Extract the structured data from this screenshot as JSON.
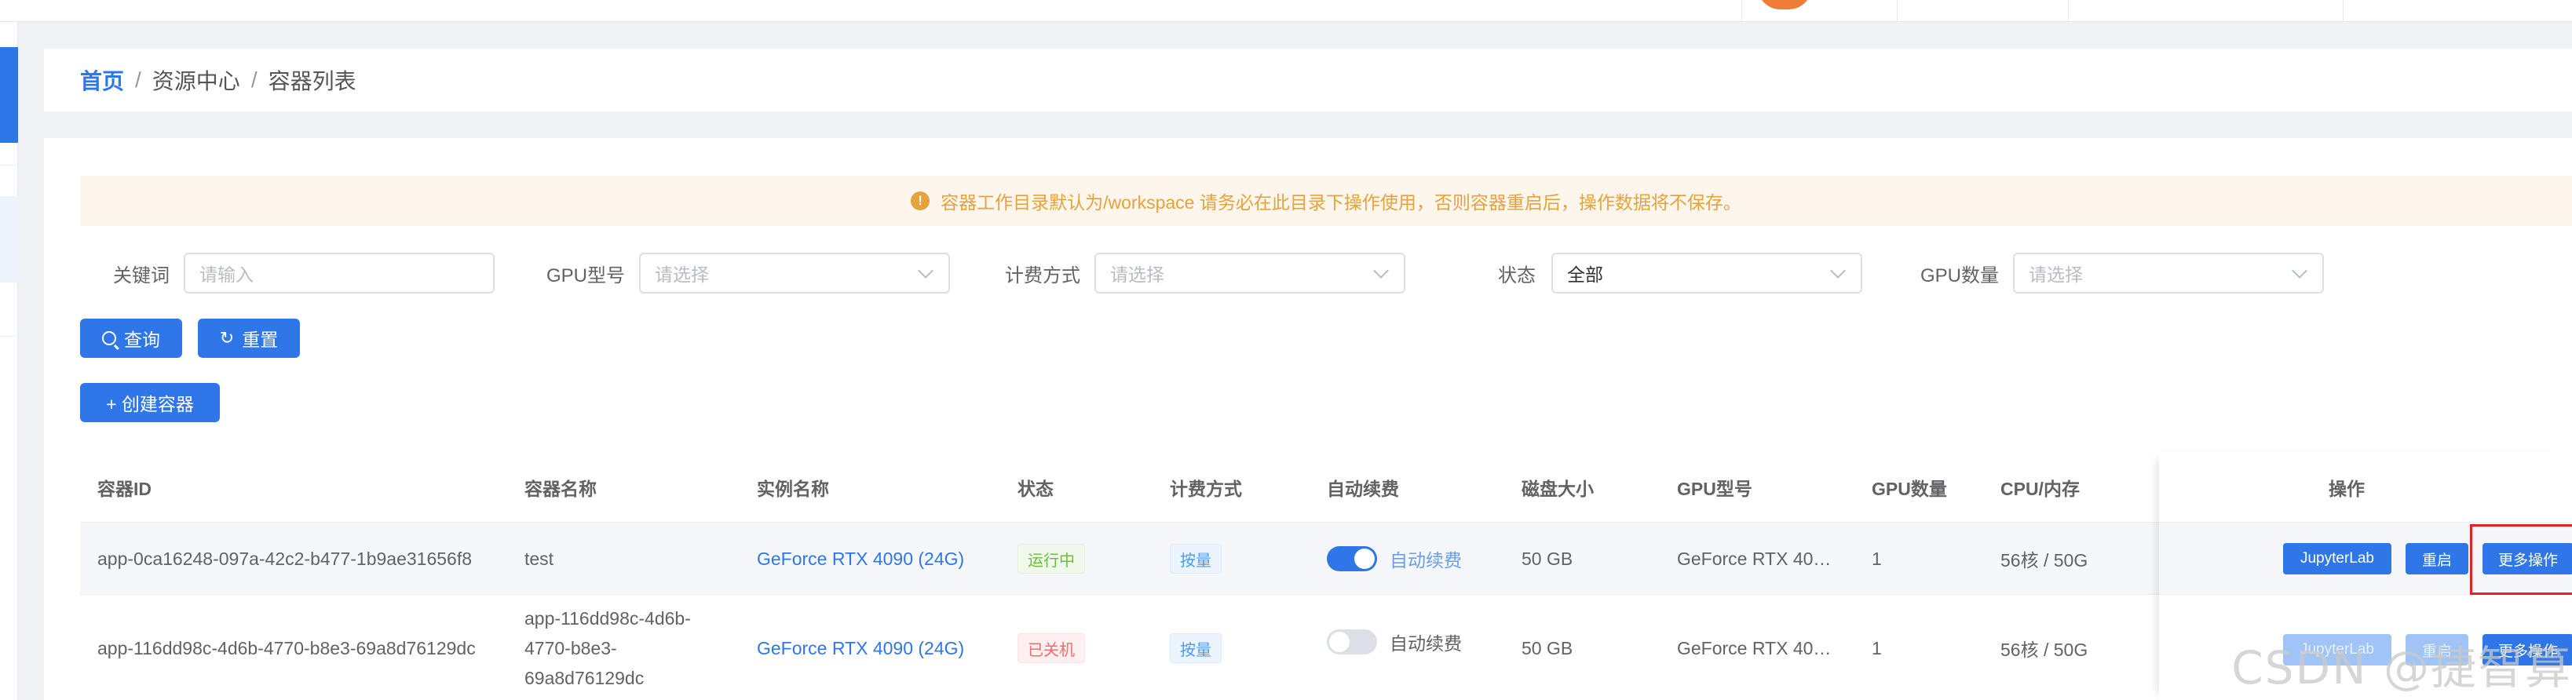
{
  "breadcrumb": {
    "home": "首页",
    "separator": "/",
    "items": [
      "资源中心",
      "容器列表"
    ]
  },
  "notice": {
    "icon": "warning-icon",
    "text": "容器工作目录默认为/workspace 请务必在此目录下操作使用，否则容器重启后，操作数据将不保存。"
  },
  "filters": {
    "keyword": {
      "label": "关键词",
      "placeholder": "请输入"
    },
    "gpu_model": {
      "label": "GPU型号",
      "placeholder": "请选择"
    },
    "billing": {
      "label": "计费方式",
      "placeholder": "请选择"
    },
    "status": {
      "label": "状态",
      "value": "全部"
    },
    "gpu_count": {
      "label": "GPU数量",
      "placeholder": "请选择"
    }
  },
  "buttons": {
    "query": "查询",
    "reset": "重置",
    "create": "+ 创建容器"
  },
  "table": {
    "columns": [
      "容器ID",
      "容器名称",
      "实例名称",
      "状态",
      "计费方式",
      "自动续费",
      "磁盘大小",
      "GPU型号",
      "GPU数量",
      "CPU/内存",
      "操作"
    ],
    "rows": [
      {
        "id": "app-0ca16248-097a-42c2-b477-1b9ae31656f8",
        "name": "test",
        "instance": "GeForce RTX 4090 (24G)",
        "status": "运行中",
        "billing": "按量",
        "auto_renew": "自动续费",
        "auto_renew_on": true,
        "disk": "50 GB",
        "gpu_model": "GeForce RTX 40…",
        "gpu_count": "1",
        "cpu_mem": "56核 / 50G",
        "ops": [
          "JupyterLab",
          "重启",
          "更多操作"
        ]
      },
      {
        "id": "app-116dd98c-4d6b-4770-b8e3-69a8d76129dc",
        "name_lines": [
          "app-116dd98c-4d6b-",
          "4770-b8e3-",
          "69a8d76129dc"
        ],
        "instance": "GeForce RTX 4090 (24G)",
        "status": "已关机",
        "billing": "按量",
        "auto_renew": "自动续费",
        "auto_renew_on": false,
        "disk": "50 GB",
        "gpu_model": "GeForce RTX 40…",
        "gpu_count": "1",
        "cpu_mem": "56核 / 50G",
        "ops": [
          "JupyterLab",
          "重启",
          "更多操作"
        ]
      }
    ]
  },
  "watermark": "CSDN @捷智算",
  "colors": {
    "primary": "#2f77e8",
    "warning": "#e6a23c",
    "success": "#67c23a",
    "danger": "#f56c6c",
    "highlight": "#e8202a"
  }
}
